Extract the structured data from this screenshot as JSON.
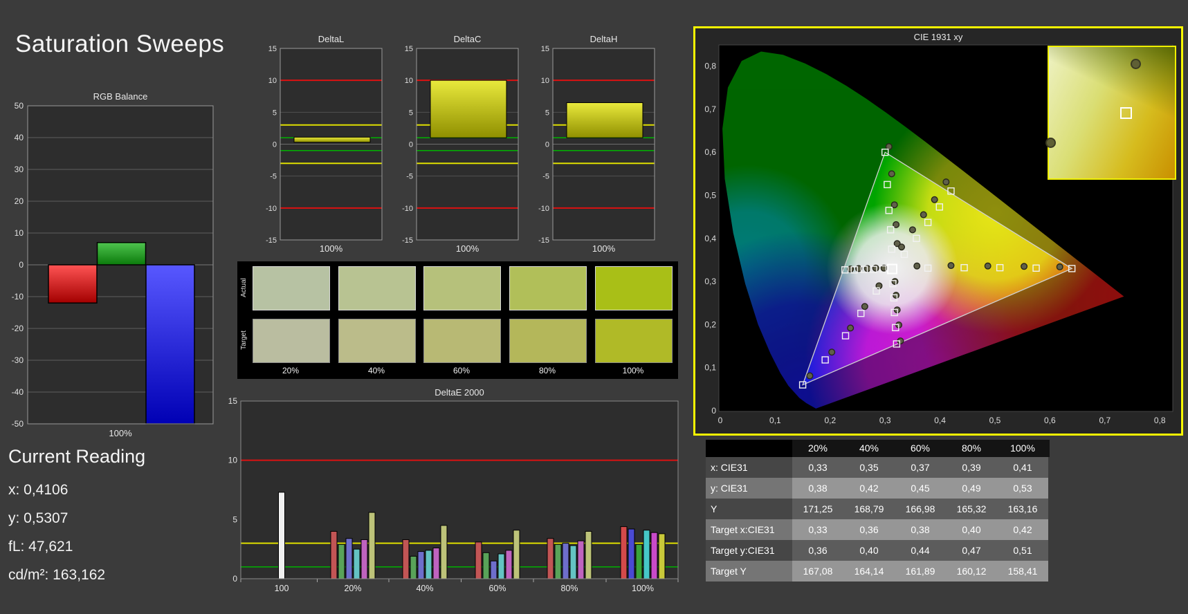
{
  "page": {
    "title": "Saturation Sweeps",
    "background": "#3b3b3b"
  },
  "current_reading": {
    "title": "Current Reading",
    "lines": [
      "x: 0,4106",
      "y: 0,5307",
      "fL: 47,621",
      "cd/m²: 163,162"
    ]
  },
  "chart_data": {
    "rgb_balance": {
      "type": "bar",
      "title": "RGB Balance",
      "xlabel": "100%",
      "ylim": [
        -50,
        50
      ],
      "ytick_step": 10,
      "bars": [
        {
          "name": "red",
          "value": -12,
          "fill": [
            "#ff5454",
            "#a30000"
          ]
        },
        {
          "name": "green",
          "value": 7,
          "fill": [
            "#4fc44f",
            "#0b7a0b"
          ]
        },
        {
          "name": "blue",
          "value": -50,
          "fill": [
            "#5858ff",
            "#0000b4"
          ]
        }
      ]
    },
    "deltaL": {
      "type": "bar",
      "title": "DeltaL",
      "xlabel": "100%",
      "ylim": [
        -15,
        15
      ],
      "limits": {
        "red": 10,
        "yellow": 3,
        "green": 1
      },
      "bar": {
        "from": 0.3,
        "to": 1.1
      }
    },
    "deltaC": {
      "type": "bar",
      "title": "DeltaC",
      "xlabel": "100%",
      "ylim": [
        -15,
        15
      ],
      "limits": {
        "red": 10,
        "yellow": 3,
        "green": 1
      },
      "bar": {
        "from": 1.0,
        "to": 10.0
      }
    },
    "deltaH": {
      "type": "bar",
      "title": "DeltaH",
      "xlabel": "100%",
      "ylim": [
        -15,
        15
      ],
      "limits": {
        "red": 10,
        "yellow": 3,
        "green": 1
      },
      "bar": {
        "from": 1.0,
        "to": 6.5
      }
    },
    "swatches": {
      "col_labels": [
        "20%",
        "40%",
        "60%",
        "80%",
        "100%"
      ],
      "rows": [
        {
          "label": "Actual",
          "colors": [
            "#b7c2a3",
            "#b8c392",
            "#b6c17b",
            "#b1bf59",
            "#a9bf17"
          ]
        },
        {
          "label": "Target",
          "colors": [
            "#babda0",
            "#bbbc8a",
            "#b8b974",
            "#b4b75a",
            "#b0ba27"
          ]
        }
      ]
    },
    "deltae2000": {
      "type": "bar",
      "title": "DeltaE 2000",
      "ylim": [
        0,
        15
      ],
      "yticks": [
        0,
        5,
        10,
        15
      ],
      "limits": {
        "red": 10,
        "yellow": 3,
        "green": 1
      },
      "groups": [
        {
          "label": "100",
          "bars": [
            {
              "v": 7.3,
              "c": "#f0f0f0"
            }
          ]
        },
        {
          "label": "20%",
          "bars": [
            {
              "v": 4.0,
              "c": "#c25555"
            },
            {
              "v": 2.9,
              "c": "#59a359"
            },
            {
              "v": 3.4,
              "c": "#6e6ecb"
            },
            {
              "v": 2.5,
              "c": "#64c3c3"
            },
            {
              "v": 3.3,
              "c": "#bf63bf"
            },
            {
              "v": 5.6,
              "c": "#bdc379"
            }
          ]
        },
        {
          "label": "40%",
          "bars": [
            {
              "v": 3.3,
              "c": "#c25555"
            },
            {
              "v": 1.9,
              "c": "#59a359"
            },
            {
              "v": 2.3,
              "c": "#6e6ecb"
            },
            {
              "v": 2.4,
              "c": "#64c3c3"
            },
            {
              "v": 2.6,
              "c": "#bf63bf"
            },
            {
              "v": 4.5,
              "c": "#bdc379"
            }
          ]
        },
        {
          "label": "60%",
          "bars": [
            {
              "v": 3.1,
              "c": "#c25555"
            },
            {
              "v": 2.2,
              "c": "#59a359"
            },
            {
              "v": 1.5,
              "c": "#6e6ecb"
            },
            {
              "v": 2.1,
              "c": "#64c3c3"
            },
            {
              "v": 2.4,
              "c": "#bf63bf"
            },
            {
              "v": 4.1,
              "c": "#bdc379"
            }
          ]
        },
        {
          "label": "80%",
          "bars": [
            {
              "v": 3.4,
              "c": "#c25555"
            },
            {
              "v": 2.9,
              "c": "#59a359"
            },
            {
              "v": 3.0,
              "c": "#6e6ecb"
            },
            {
              "v": 2.8,
              "c": "#64c3c3"
            },
            {
              "v": 3.2,
              "c": "#bf63bf"
            },
            {
              "v": 4.0,
              "c": "#bdc379"
            }
          ]
        },
        {
          "label": "100%",
          "bars": [
            {
              "v": 4.4,
              "c": "#d34a4a"
            },
            {
              "v": 4.2,
              "c": "#4a4ad3"
            },
            {
              "v": 2.9,
              "c": "#3aa33a"
            },
            {
              "v": 4.1,
              "c": "#46c8c8"
            },
            {
              "v": 3.9,
              "c": "#c94ac9"
            },
            {
              "v": 3.8,
              "c": "#c9c93a"
            }
          ]
        }
      ]
    },
    "cie": {
      "type": "scatter",
      "title": "CIE 1931 xy",
      "xlim": [
        0,
        0.8
      ],
      "ylim": [
        0,
        0.8
      ],
      "xticks": [
        "0",
        "0,1",
        "0,2",
        "0,3",
        "0,4",
        "0,5",
        "0,6",
        "0,7",
        "0,8"
      ],
      "yticks": [
        "0",
        "0,1",
        "0,2",
        "0,3",
        "0,4",
        "0,5",
        "0,6",
        "0,7",
        "0,8"
      ],
      "white_point": [
        0.313,
        0.329
      ],
      "gamut_triangle": [
        [
          0.64,
          0.33
        ],
        [
          0.3,
          0.6
        ],
        [
          0.15,
          0.06
        ]
      ],
      "locus": [
        [
          0.1741,
          0.005
        ],
        [
          0.1566,
          0.0177
        ],
        [
          0.144,
          0.0297
        ],
        [
          0.1241,
          0.0578
        ],
        [
          0.1096,
          0.0868
        ],
        [
          0.0913,
          0.1327
        ],
        [
          0.0687,
          0.2007
        ],
        [
          0.0454,
          0.295
        ],
        [
          0.0235,
          0.4127
        ],
        [
          0.0082,
          0.5384
        ],
        [
          0.0039,
          0.6548
        ],
        [
          0.0139,
          0.7502
        ],
        [
          0.0389,
          0.812
        ],
        [
          0.0743,
          0.8338
        ],
        [
          0.1142,
          0.8262
        ],
        [
          0.1547,
          0.8059
        ],
        [
          0.1929,
          0.7816
        ],
        [
          0.2296,
          0.7543
        ],
        [
          0.2658,
          0.7243
        ],
        [
          0.3016,
          0.6923
        ],
        [
          0.3373,
          0.6589
        ],
        [
          0.3731,
          0.6245
        ],
        [
          0.4087,
          0.5896
        ],
        [
          0.4441,
          0.5547
        ],
        [
          0.4788,
          0.5202
        ],
        [
          0.5125,
          0.4866
        ],
        [
          0.5448,
          0.4544
        ],
        [
          0.5752,
          0.4242
        ],
        [
          0.6029,
          0.3965
        ],
        [
          0.627,
          0.3725
        ],
        [
          0.6482,
          0.3514
        ],
        [
          0.6658,
          0.334
        ],
        [
          0.6915,
          0.3083
        ],
        [
          0.7079,
          0.292
        ],
        [
          0.719,
          0.2809
        ],
        [
          0.7347,
          0.2653
        ]
      ],
      "sweeps": [
        {
          "name": "red",
          "targets": [
            [
              0.378,
              0.331
            ],
            [
              0.444,
              0.332
            ],
            [
              0.509,
              0.332
            ],
            [
              0.575,
              0.331
            ],
            [
              0.64,
              0.33
            ]
          ],
          "measured": [
            [
              0.358,
              0.336
            ],
            [
              0.42,
              0.337
            ],
            [
              0.487,
              0.336
            ],
            [
              0.553,
              0.335
            ],
            [
              0.618,
              0.334
            ]
          ]
        },
        {
          "name": "green",
          "targets": [
            [
              0.312,
              0.375
            ],
            [
              0.31,
              0.42
            ],
            [
              0.307,
              0.465
            ],
            [
              0.304,
              0.525
            ],
            [
              0.3,
              0.6
            ]
          ],
          "measured": [
            [
              0.322,
              0.388
            ],
            [
              0.32,
              0.432
            ],
            [
              0.317,
              0.478
            ],
            [
              0.312,
              0.55
            ],
            [
              0.307,
              0.613
            ]
          ]
        },
        {
          "name": "blue",
          "targets": [
            [
              0.284,
              0.278
            ],
            [
              0.256,
              0.226
            ],
            [
              0.228,
              0.174
            ],
            [
              0.191,
              0.118
            ],
            [
              0.15,
              0.06
            ]
          ],
          "measured": [
            [
              0.289,
              0.29
            ],
            [
              0.263,
              0.242
            ],
            [
              0.237,
              0.192
            ],
            [
              0.203,
              0.136
            ],
            [
              0.163,
              0.081
            ]
          ]
        },
        {
          "name": "cyan",
          "targets": [
            [
              0.296,
              0.329
            ],
            [
              0.279,
              0.328
            ],
            [
              0.262,
              0.328
            ],
            [
              0.244,
              0.327
            ],
            [
              0.227,
              0.327
            ]
          ],
          "measured": [
            [
              0.298,
              0.331
            ],
            [
              0.283,
              0.331
            ],
            [
              0.268,
              0.33
            ],
            [
              0.252,
              0.33
            ],
            [
              0.237,
              0.329
            ]
          ]
        },
        {
          "name": "magenta",
          "targets": [
            [
              0.314,
              0.295
            ],
            [
              0.316,
              0.262
            ],
            [
              0.317,
              0.228
            ],
            [
              0.319,
              0.193
            ],
            [
              0.321,
              0.155
            ]
          ],
          "measured": [
            [
              0.318,
              0.3
            ],
            [
              0.32,
              0.268
            ],
            [
              0.322,
              0.234
            ],
            [
              0.325,
              0.199
            ],
            [
              0.328,
              0.162
            ]
          ]
        },
        {
          "name": "yellow",
          "targets": [
            [
              0.335,
              0.363
            ],
            [
              0.357,
              0.4
            ],
            [
              0.378,
              0.437
            ],
            [
              0.399,
              0.473
            ],
            [
              0.42,
              0.51
            ]
          ],
          "measured": [
            [
              0.33,
              0.38
            ],
            [
              0.35,
              0.42
            ],
            [
              0.37,
              0.455
            ],
            [
              0.39,
              0.49
            ],
            [
              0.411,
              0.531
            ]
          ]
        }
      ],
      "inset_markers": [
        {
          "type": "circle",
          "x": 0.68,
          "y": 0.12
        },
        {
          "type": "square",
          "x": 0.6,
          "y": 0.49
        },
        {
          "type": "circle",
          "x": 0.005,
          "y": 0.72
        }
      ]
    },
    "table": {
      "col_headers": [
        "20%",
        "40%",
        "60%",
        "80%",
        "100%"
      ],
      "rows": [
        {
          "label": "x: CIE31",
          "values": [
            "0,33",
            "0,35",
            "0,37",
            "0,39",
            "0,41"
          ]
        },
        {
          "label": "y: CIE31",
          "values": [
            "0,38",
            "0,42",
            "0,45",
            "0,49",
            "0,53"
          ]
        },
        {
          "label": "Y",
          "values": [
            "171,25",
            "168,79",
            "166,98",
            "165,32",
            "163,16"
          ]
        },
        {
          "label": "Target x:CIE31",
          "values": [
            "0,33",
            "0,36",
            "0,38",
            "0,40",
            "0,42"
          ]
        },
        {
          "label": "Target y:CIE31",
          "values": [
            "0,36",
            "0,40",
            "0,44",
            "0,47",
            "0,51"
          ]
        },
        {
          "label": "Target Y",
          "values": [
            "167,08",
            "164,14",
            "161,89",
            "160,12",
            "158,41"
          ]
        }
      ]
    }
  }
}
